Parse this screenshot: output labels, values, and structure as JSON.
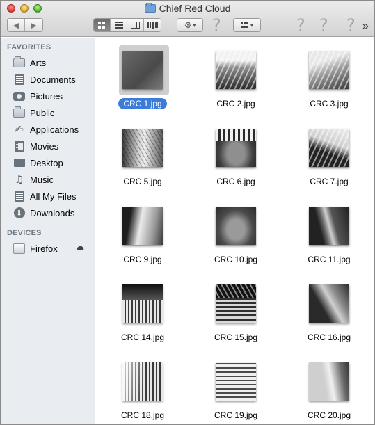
{
  "window": {
    "title": "Chief Red Cloud"
  },
  "toolbar": {
    "back_icon": "chevron-left-icon",
    "forward_icon": "chevron-right-icon",
    "view_modes": [
      "icon-view",
      "list-view",
      "column-view",
      "coverflow-view"
    ],
    "active_view": "icon-view",
    "action_icon": "gear-icon",
    "arrange_icon": "arrange-icon",
    "help_glyph": "?",
    "overflow_glyph": "»"
  },
  "sidebar": {
    "favorites_heading": "FAVORITES",
    "favorites": [
      {
        "label": "Arts",
        "icon": "folder-icon"
      },
      {
        "label": "Documents",
        "icon": "documents-icon"
      },
      {
        "label": "Pictures",
        "icon": "camera-icon"
      },
      {
        "label": "Public",
        "icon": "folder-icon"
      },
      {
        "label": "Applications",
        "icon": "applications-icon"
      },
      {
        "label": "Movies",
        "icon": "film-icon"
      },
      {
        "label": "Desktop",
        "icon": "desktop-icon"
      },
      {
        "label": "Music",
        "icon": "music-icon"
      },
      {
        "label": "All My Files",
        "icon": "all-files-icon"
      },
      {
        "label": "Downloads",
        "icon": "downloads-icon"
      }
    ],
    "devices_heading": "DEVICES",
    "devices": [
      {
        "label": "Firefox",
        "icon": "disk-icon"
      }
    ],
    "eject_glyph": "⏏"
  },
  "files": [
    {
      "name": "CRC 1.jpg",
      "selected": true
    },
    {
      "name": "CRC 2.jpg"
    },
    {
      "name": "CRC 3.jpg"
    },
    {
      "name": "CRC 5.jpg"
    },
    {
      "name": "CRC 6.jpg"
    },
    {
      "name": "CRC 7.jpg"
    },
    {
      "name": "CRC 9.jpg"
    },
    {
      "name": "CRC 10.jpg"
    },
    {
      "name": "CRC 11.jpg"
    },
    {
      "name": "CRC 14.jpg"
    },
    {
      "name": "CRC 15.jpg"
    },
    {
      "name": "CRC 16.jpg"
    },
    {
      "name": "CRC 18.jpg"
    },
    {
      "name": "CRC 19.jpg"
    },
    {
      "name": "CRC 20.jpg"
    }
  ],
  "colors": {
    "selection": "#3d7bd9",
    "sidebar_bg": "#e9ecf0",
    "section_heading": "#6f7680"
  }
}
